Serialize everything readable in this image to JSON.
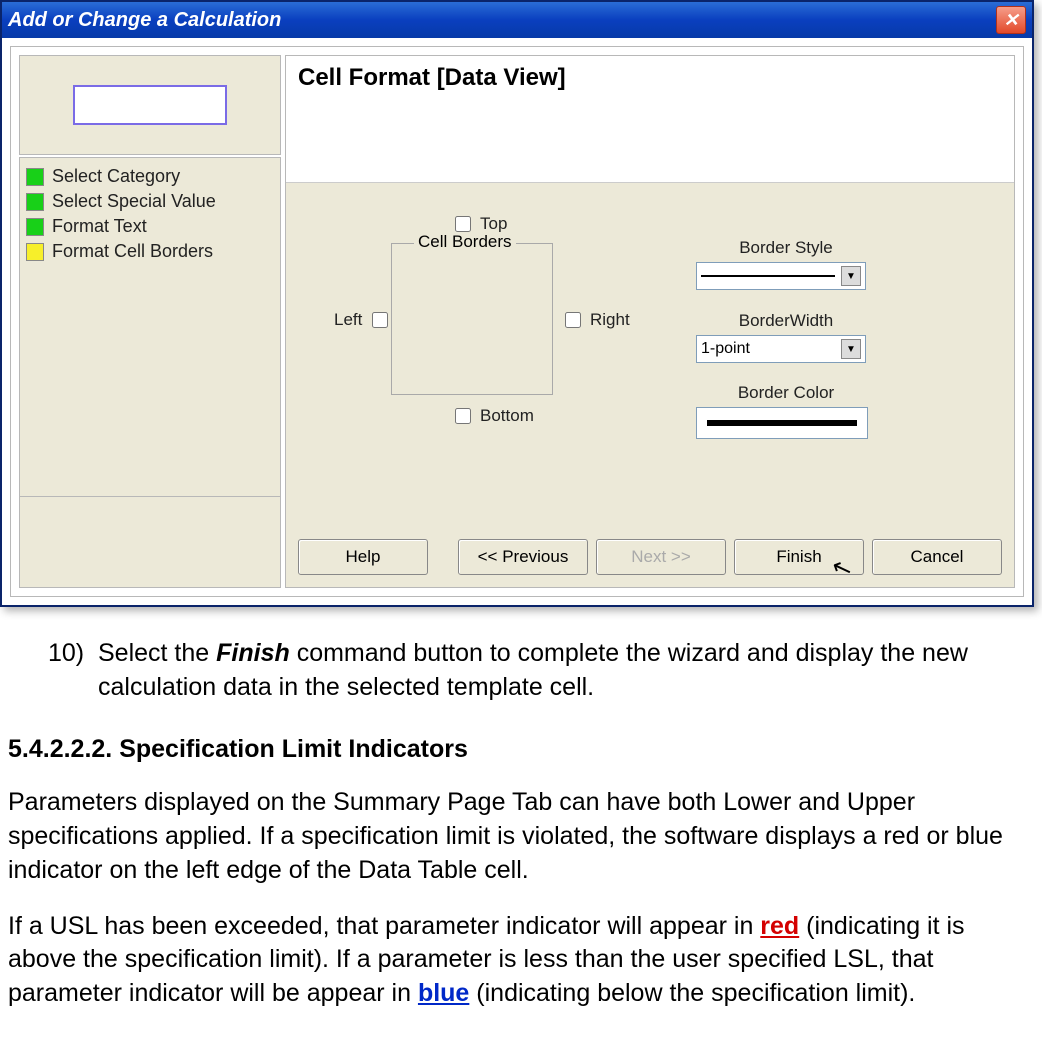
{
  "dialog": {
    "title": "Add or Change a Calculation",
    "close_tooltip": "Close",
    "panel_title": "Cell Format [Data View]",
    "steps": [
      {
        "label": "Select Category",
        "color": "green"
      },
      {
        "label": "Select Special Value",
        "color": "green"
      },
      {
        "label": "Format Text",
        "color": "green"
      },
      {
        "label": "Format Cell Borders",
        "color": "yellow"
      }
    ],
    "borders": {
      "fieldset_title": "Cell Borders",
      "top": "Top",
      "right": "Right",
      "bottom": "Bottom",
      "left": "Left"
    },
    "border_style_label": "Border Style",
    "border_width_label": "BorderWidth",
    "border_width_value": "1-point",
    "border_color_label": "Border Color",
    "buttons": {
      "help": "Help",
      "prev": "<< Previous",
      "next": "Next >>",
      "finish": "Finish",
      "cancel": "Cancel"
    }
  },
  "doc": {
    "step_number": "10)",
    "step_text_a": "Select the ",
    "step_text_kw": "Finish",
    "step_text_b": " command button to complete the wizard and display the new calculation data in the selected template cell.",
    "heading": "5.4.2.2.2. Specification Limit Indicators",
    "para1": "Parameters displayed on the Summary Page Tab can have both Lower and Upper specifications applied. If a specification limit is violated, the software displays a red or blue indicator on the left edge of the Data Table cell.",
    "para2_a": "If a USL has been exceeded, that parameter indicator will appear in ",
    "para2_red": "red",
    "para2_b": " (indicating it is above the specification limit). If a parameter is less than the user specified LSL, that parameter indicator will be appear in ",
    "para2_blue": "blue",
    "para2_c": " (indicating below the specification limit)."
  }
}
